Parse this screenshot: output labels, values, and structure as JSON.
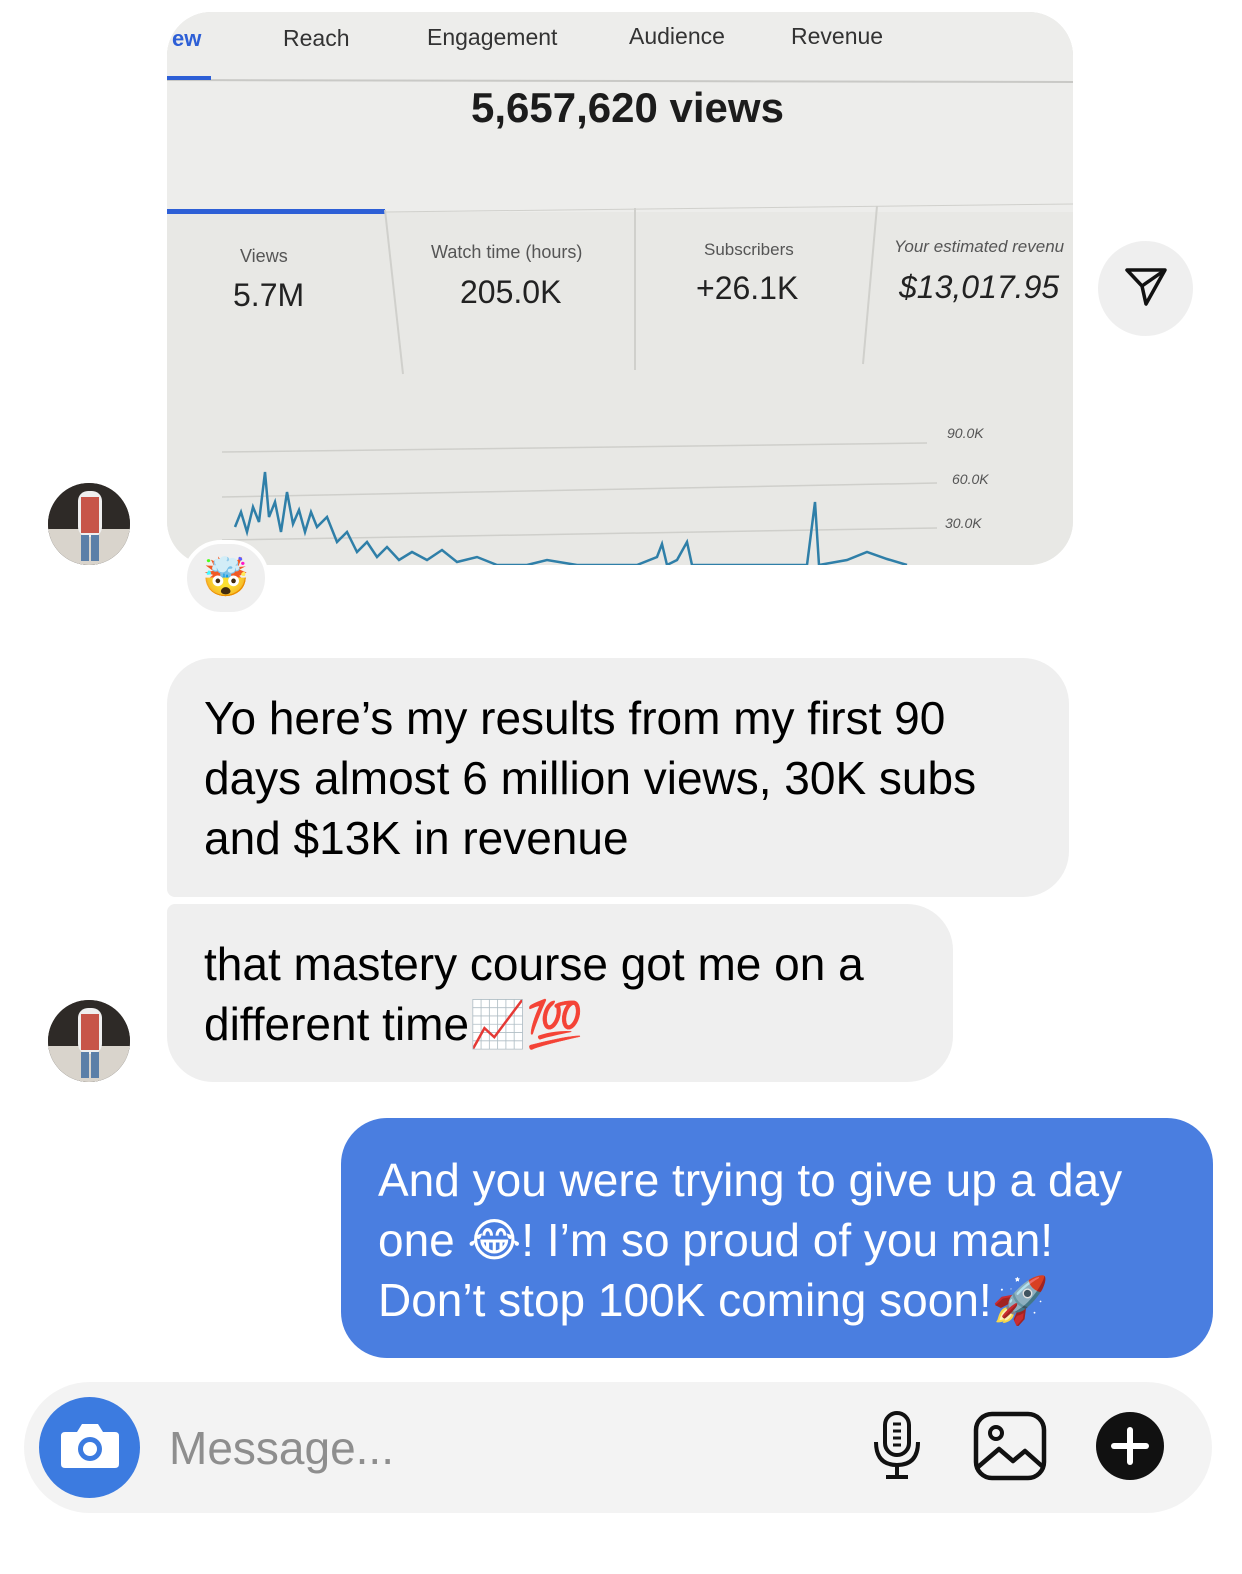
{
  "photo": {
    "tabs": [
      "ew",
      "Reach",
      "Engagement",
      "Audience",
      "Revenue"
    ],
    "total_views": "5,657,620 views",
    "cards": [
      {
        "label": "Views",
        "value": "5.7M"
      },
      {
        "label": "Watch time (hours)",
        "value": "205.0K"
      },
      {
        "label": "Subscribers",
        "value": "+26.1K"
      },
      {
        "label": "Your estimated revenu",
        "value": "$13,017.95"
      }
    ],
    "chart_ticks": [
      "90.0K",
      "60.0K",
      "30.0K"
    ]
  },
  "reaction_emoji": "🤯",
  "messages": [
    {
      "line1": "Yo here’s my results from my first 90",
      "line2": "days almost 6 million views, 30K subs",
      "line3": "and $13K in revenue"
    },
    {
      "line1": "that mastery course got me on a",
      "line2": "different time",
      "emoji": "📈💯"
    },
    {
      "line1": "And you were trying to give up a day",
      "line2a": "one ",
      "emoji1": "😂",
      "line2b": "! I’m so proud of you man!",
      "line3": "Don’t stop 100K coming soon!",
      "emoji2": "🚀"
    }
  ],
  "composer": {
    "placeholder": "Message..."
  },
  "colors": {
    "outgoing_bubble": "#4a7ee0",
    "incoming_bubble": "#efefef",
    "camera_button": "#3c7be0"
  }
}
